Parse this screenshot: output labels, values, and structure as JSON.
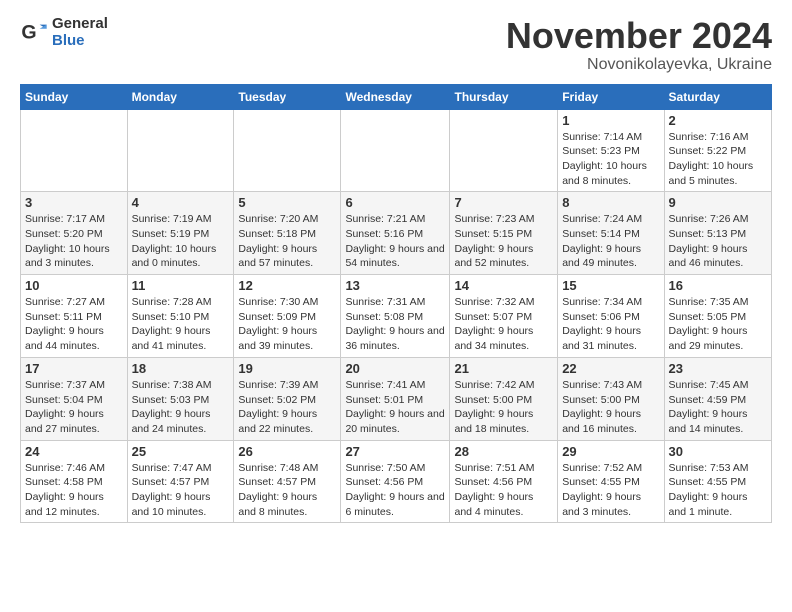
{
  "logo": {
    "general": "General",
    "blue": "Blue"
  },
  "title": {
    "month": "November 2024",
    "location": "Novonikolayevka, Ukraine"
  },
  "headers": [
    "Sunday",
    "Monday",
    "Tuesday",
    "Wednesday",
    "Thursday",
    "Friday",
    "Saturday"
  ],
  "weeks": [
    [
      {
        "day": "",
        "info": ""
      },
      {
        "day": "",
        "info": ""
      },
      {
        "day": "",
        "info": ""
      },
      {
        "day": "",
        "info": ""
      },
      {
        "day": "",
        "info": ""
      },
      {
        "day": "1",
        "info": "Sunrise: 7:14 AM\nSunset: 5:23 PM\nDaylight: 10 hours and 8 minutes."
      },
      {
        "day": "2",
        "info": "Sunrise: 7:16 AM\nSunset: 5:22 PM\nDaylight: 10 hours and 5 minutes."
      }
    ],
    [
      {
        "day": "3",
        "info": "Sunrise: 7:17 AM\nSunset: 5:20 PM\nDaylight: 10 hours and 3 minutes."
      },
      {
        "day": "4",
        "info": "Sunrise: 7:19 AM\nSunset: 5:19 PM\nDaylight: 10 hours and 0 minutes."
      },
      {
        "day": "5",
        "info": "Sunrise: 7:20 AM\nSunset: 5:18 PM\nDaylight: 9 hours and 57 minutes."
      },
      {
        "day": "6",
        "info": "Sunrise: 7:21 AM\nSunset: 5:16 PM\nDaylight: 9 hours and 54 minutes."
      },
      {
        "day": "7",
        "info": "Sunrise: 7:23 AM\nSunset: 5:15 PM\nDaylight: 9 hours and 52 minutes."
      },
      {
        "day": "8",
        "info": "Sunrise: 7:24 AM\nSunset: 5:14 PM\nDaylight: 9 hours and 49 minutes."
      },
      {
        "day": "9",
        "info": "Sunrise: 7:26 AM\nSunset: 5:13 PM\nDaylight: 9 hours and 46 minutes."
      }
    ],
    [
      {
        "day": "10",
        "info": "Sunrise: 7:27 AM\nSunset: 5:11 PM\nDaylight: 9 hours and 44 minutes."
      },
      {
        "day": "11",
        "info": "Sunrise: 7:28 AM\nSunset: 5:10 PM\nDaylight: 9 hours and 41 minutes."
      },
      {
        "day": "12",
        "info": "Sunrise: 7:30 AM\nSunset: 5:09 PM\nDaylight: 9 hours and 39 minutes."
      },
      {
        "day": "13",
        "info": "Sunrise: 7:31 AM\nSunset: 5:08 PM\nDaylight: 9 hours and 36 minutes."
      },
      {
        "day": "14",
        "info": "Sunrise: 7:32 AM\nSunset: 5:07 PM\nDaylight: 9 hours and 34 minutes."
      },
      {
        "day": "15",
        "info": "Sunrise: 7:34 AM\nSunset: 5:06 PM\nDaylight: 9 hours and 31 minutes."
      },
      {
        "day": "16",
        "info": "Sunrise: 7:35 AM\nSunset: 5:05 PM\nDaylight: 9 hours and 29 minutes."
      }
    ],
    [
      {
        "day": "17",
        "info": "Sunrise: 7:37 AM\nSunset: 5:04 PM\nDaylight: 9 hours and 27 minutes."
      },
      {
        "day": "18",
        "info": "Sunrise: 7:38 AM\nSunset: 5:03 PM\nDaylight: 9 hours and 24 minutes."
      },
      {
        "day": "19",
        "info": "Sunrise: 7:39 AM\nSunset: 5:02 PM\nDaylight: 9 hours and 22 minutes."
      },
      {
        "day": "20",
        "info": "Sunrise: 7:41 AM\nSunset: 5:01 PM\nDaylight: 9 hours and 20 minutes."
      },
      {
        "day": "21",
        "info": "Sunrise: 7:42 AM\nSunset: 5:00 PM\nDaylight: 9 hours and 18 minutes."
      },
      {
        "day": "22",
        "info": "Sunrise: 7:43 AM\nSunset: 5:00 PM\nDaylight: 9 hours and 16 minutes."
      },
      {
        "day": "23",
        "info": "Sunrise: 7:45 AM\nSunset: 4:59 PM\nDaylight: 9 hours and 14 minutes."
      }
    ],
    [
      {
        "day": "24",
        "info": "Sunrise: 7:46 AM\nSunset: 4:58 PM\nDaylight: 9 hours and 12 minutes."
      },
      {
        "day": "25",
        "info": "Sunrise: 7:47 AM\nSunset: 4:57 PM\nDaylight: 9 hours and 10 minutes."
      },
      {
        "day": "26",
        "info": "Sunrise: 7:48 AM\nSunset: 4:57 PM\nDaylight: 9 hours and 8 minutes."
      },
      {
        "day": "27",
        "info": "Sunrise: 7:50 AM\nSunset: 4:56 PM\nDaylight: 9 hours and 6 minutes."
      },
      {
        "day": "28",
        "info": "Sunrise: 7:51 AM\nSunset: 4:56 PM\nDaylight: 9 hours and 4 minutes."
      },
      {
        "day": "29",
        "info": "Sunrise: 7:52 AM\nSunset: 4:55 PM\nDaylight: 9 hours and 3 minutes."
      },
      {
        "day": "30",
        "info": "Sunrise: 7:53 AM\nSunset: 4:55 PM\nDaylight: 9 hours and 1 minute."
      }
    ]
  ]
}
